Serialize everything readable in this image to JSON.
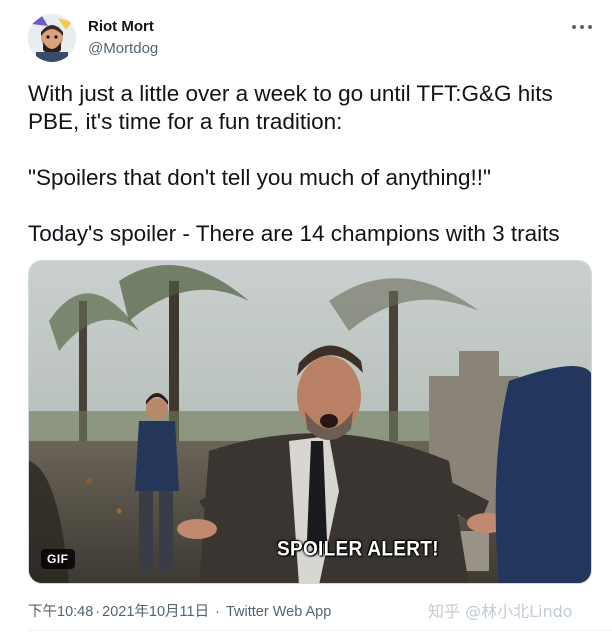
{
  "author": {
    "name": "Riot Mort",
    "handle": "@Mortdog"
  },
  "tweet": {
    "lines": [
      "With just a little over a week to go until TFT:G&G hits PBE, it's time for a fun tradition:",
      "\"Spoilers that don't tell you much of anything!!\"",
      "Today's spoiler - There are 14 champions with 3 traits"
    ]
  },
  "media": {
    "badge": "GIF",
    "caption": "SPOILER ALERT!"
  },
  "meta": {
    "time": "下午10:48",
    "separator": "·",
    "date": "2021年10月11日",
    "source": "Twitter Web App"
  },
  "watermark": "知乎 @林小北Lindo",
  "icons": {
    "more": "more-horizontal-icon"
  },
  "colors": {
    "text": "#0f1419",
    "secondary": "#536471"
  }
}
